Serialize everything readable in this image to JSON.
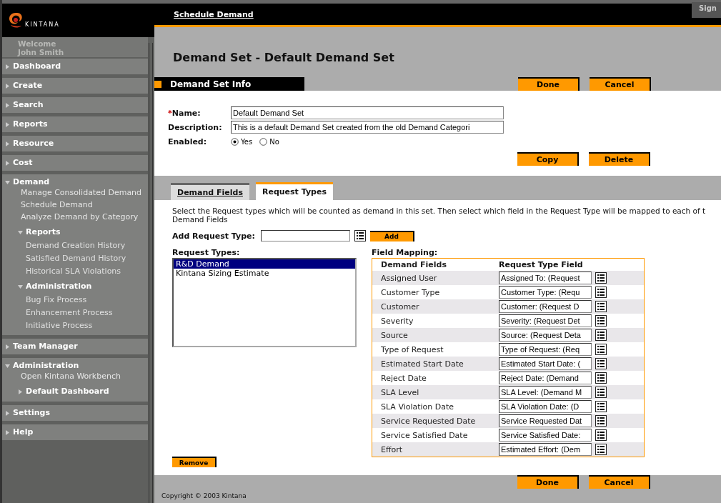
{
  "logo": {
    "wordmark": "KINTANA"
  },
  "sidebar": {
    "welcome": "Welcome",
    "user": "John Smith",
    "sections": [
      {
        "label": "Dashboard",
        "expanded": false
      },
      {
        "label": "Create",
        "expanded": false
      },
      {
        "label": "Search",
        "expanded": false
      },
      {
        "label": "Reports",
        "expanded": false
      },
      {
        "label": "Resource",
        "expanded": false
      },
      {
        "label": "Cost",
        "expanded": false
      },
      {
        "label": "Demand",
        "expanded": true,
        "children": [
          {
            "kind": "link",
            "label": "Manage Consolidated Demand"
          },
          {
            "kind": "link",
            "label": "Schedule Demand"
          },
          {
            "kind": "link",
            "label": "Analyze Demand by Category"
          },
          {
            "kind": "group",
            "label": "Reports",
            "expanded": true,
            "children": [
              {
                "label": "Demand Creation History"
              },
              {
                "label": "Satisfied Demand History"
              },
              {
                "label": "Historical SLA Violations"
              }
            ]
          },
          {
            "kind": "group",
            "label": "Administration",
            "expanded": true,
            "children": [
              {
                "label": "Bug Fix Process"
              },
              {
                "label": "Enhancement Process"
              },
              {
                "label": "Initiative Process"
              }
            ]
          }
        ]
      },
      {
        "label": "Team Manager",
        "expanded": false
      },
      {
        "label": "Administration",
        "expanded": true,
        "children": [
          {
            "kind": "link",
            "label": "Open Kintana Workbench"
          },
          {
            "kind": "group",
            "label": "Default Dashboard",
            "expanded": false
          }
        ]
      },
      {
        "label": "Settings",
        "expanded": false
      },
      {
        "label": "Help",
        "expanded": false
      }
    ]
  },
  "header": {
    "breadcrumb": "Schedule Demand",
    "sign_out": "Sign"
  },
  "page_title": "Demand Set - Default Demand Set",
  "section_title": "Demand Set Info",
  "top_buttons": [
    "Done",
    "Cancel"
  ],
  "form": {
    "required_mark": "*",
    "name_label": "Name:",
    "name_value": "Default Demand Set",
    "description_label": "Description:",
    "description_value": "This is a default Demand Set created from the old Demand Categori",
    "enabled_label": "Enabled:",
    "enabled_options": [
      {
        "label": "Yes",
        "selected": true
      },
      {
        "label": "No",
        "selected": false
      }
    ]
  },
  "form_buttons": [
    "Copy",
    "Delete"
  ],
  "tabs": [
    {
      "label": "Demand Fields",
      "selected": false
    },
    {
      "label": "Request Types",
      "selected": true
    }
  ],
  "instructions": "Select the Request types which will be counted as demand in this set. Then select which field in the Request Type will be mapped to each of t",
  "instructions_line2": "Demand Fields",
  "add_request_type": {
    "label": "Add Request Type:",
    "button": "Add"
  },
  "request_types": {
    "label": "Request Types:",
    "items": [
      {
        "label": "R&D Demand",
        "selected": true
      },
      {
        "label": "Kintana Sizing Estimate",
        "selected": false
      }
    ]
  },
  "remove_button": "Remove",
  "field_mapping": {
    "label": "Field Mapping:",
    "columns": [
      "Demand Fields",
      "Request Type Field"
    ],
    "rows": [
      {
        "field": "Assigned User",
        "value": "Assigned To: (Request"
      },
      {
        "field": "Customer Type",
        "value": "Customer Type: (Requ"
      },
      {
        "field": "Customer",
        "value": "Customer: (Request D"
      },
      {
        "field": "Severity",
        "value": "Severity: (Request Det"
      },
      {
        "field": "Source",
        "value": "Source: (Request Deta"
      },
      {
        "field": "Type of Request",
        "value": "Type of Request: (Req"
      },
      {
        "field": "Estimated Start Date",
        "value": "Estimated Start Date: ("
      },
      {
        "field": "Reject Date",
        "value": "Reject Date: (Demand"
      },
      {
        "field": "SLA Level",
        "value": "SLA Level: (Demand M"
      },
      {
        "field": "SLA Violation Date",
        "value": "SLA Violation Date: (D"
      },
      {
        "field": "Service Requested Date",
        "value": "Service Requested Dat"
      },
      {
        "field": "Service Satisfied Date",
        "value": "Service Satisfied Date:"
      },
      {
        "field": "Effort",
        "value": "Estimated Effort: (Dem"
      }
    ]
  },
  "bottom_buttons": [
    "Done",
    "Cancel"
  ],
  "footer": "Copyright © 2003 Kintana"
}
